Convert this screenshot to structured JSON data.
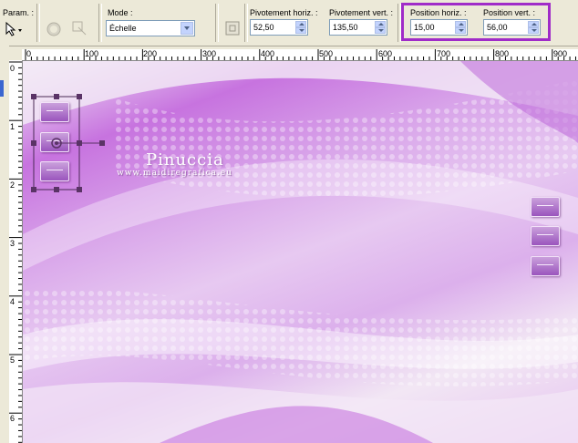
{
  "toolbar": {
    "params_label": "Param. :",
    "mode_label": "Mode :",
    "mode_value": "Échelle",
    "pivot_h_label": "Pivotement horiz. :",
    "pivot_h_value": "52,50",
    "pivot_v_label": "Pivotement vert. :",
    "pivot_v_value": "135,50",
    "pos_h_label": "Position horiz. :",
    "pos_h_value": "15,00",
    "pos_v_label": "Position vert. :",
    "pos_v_value": "56,00"
  },
  "ruler": {
    "top_ticks": [
      "0",
      "100",
      "200",
      "300",
      "400",
      "500",
      "600",
      "700",
      "800",
      "900"
    ],
    "left_ticks": [
      "0",
      "1",
      "2",
      "3",
      "4",
      "5",
      "6"
    ]
  },
  "canvas": {
    "watermark_title": "Pinuccia",
    "watermark_url": "www.maidiregrafica.eu"
  },
  "colors": {
    "highlight": "#a02cc8",
    "toolbar_bg": "#ece9d8",
    "canvas_accent": "#c773df"
  }
}
